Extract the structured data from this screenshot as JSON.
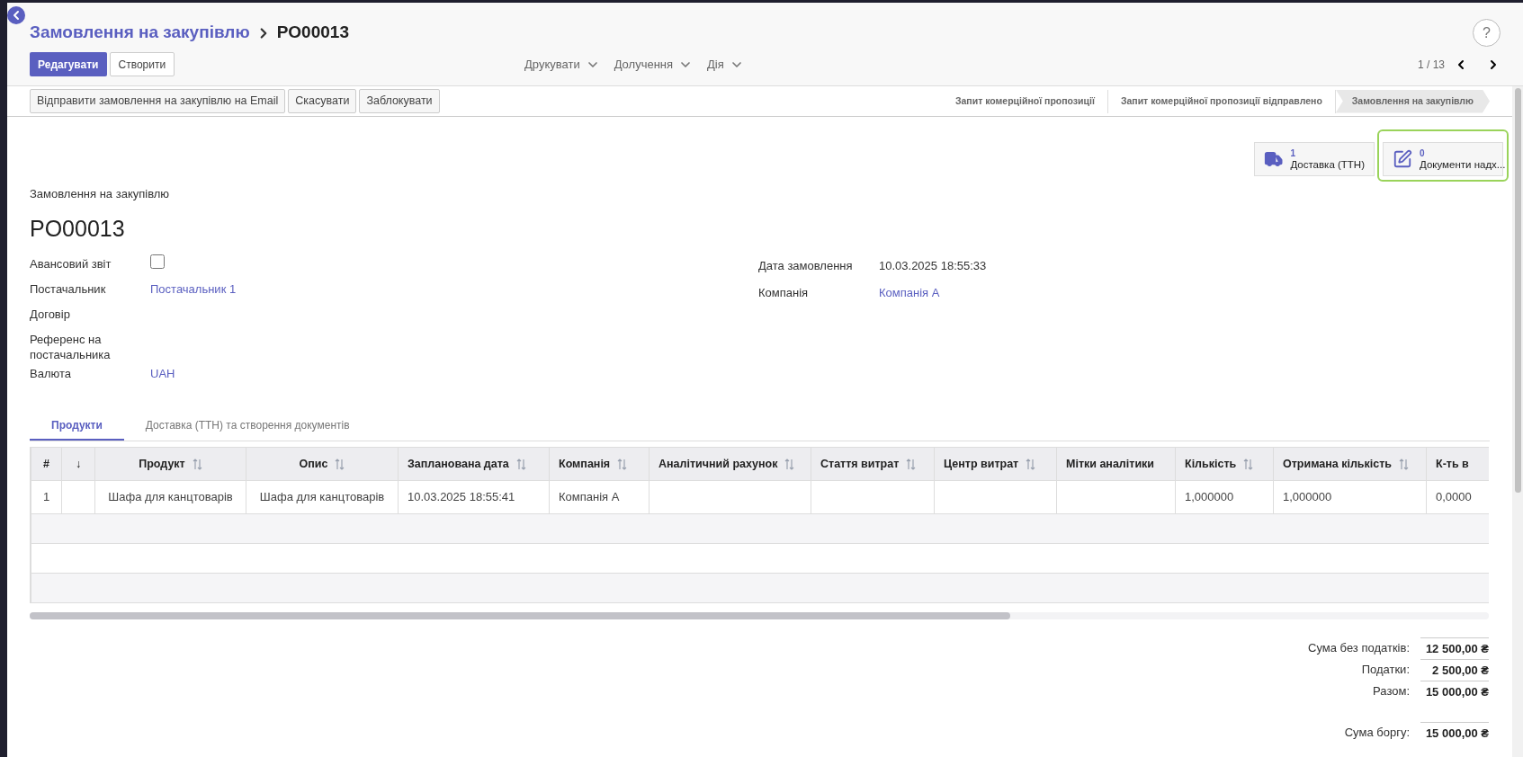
{
  "breadcrumb": {
    "parent": "Замовлення на закупівлю",
    "current": "PO00013"
  },
  "help": {
    "label": "?"
  },
  "main_buttons": [
    {
      "label": "Редагувати",
      "primary": true
    },
    {
      "label": "Створити",
      "primary": false
    }
  ],
  "dropdowns": [
    "Друкувати",
    "Долучення",
    "Дія"
  ],
  "pager": {
    "label": "1 / 13"
  },
  "action_buttons": [
    "Відправити замовлення на закупівлю на Email",
    "Скасувати",
    "Заблокувати"
  ],
  "status_stages": [
    {
      "label": "Запит комерційної пропозиції",
      "selected": false
    },
    {
      "label": "Запит комерційної пропозиції відправлено",
      "selected": false
    },
    {
      "label": "Замовлення на закупівлю",
      "selected": true
    }
  ],
  "smart_buttons": [
    {
      "kind": "truck",
      "count": "1",
      "label": "Доставка (ТТН)",
      "focused": false
    },
    {
      "kind": "edit",
      "count": "0",
      "label": "Документи надх...",
      "focused": true
    }
  ],
  "form": {
    "subtitle": "Замовлення на закупівлю",
    "name": "PO00013",
    "left_fields": [
      {
        "label": "Авансовий звіт",
        "kind": "checkbox",
        "checked": false
      },
      {
        "label": "Постачальник",
        "kind": "link",
        "value": "Постачальник 1"
      },
      {
        "label": "Договір",
        "kind": "text"
      },
      {
        "label": "Референс на постачальника",
        "kind": "text"
      },
      {
        "label": "Валюта",
        "kind": "link",
        "value": "UAH"
      }
    ],
    "right_fields": [
      {
        "label": "Дата замовлення",
        "kind": "text",
        "value": "10.03.2025 18:55:33"
      },
      {
        "label": "Компанія",
        "kind": "link",
        "value": "Компанія A"
      }
    ]
  },
  "tabs": [
    {
      "label": "Продукти",
      "selected": true
    },
    {
      "label": "Доставка (ТТН) та створення документів",
      "selected": false
    }
  ],
  "table": {
    "columns": [
      {
        "label": "#",
        "sortable": false
      },
      {
        "label": "↓",
        "sortable": false
      },
      {
        "label": "Продукт",
        "sortable": true
      },
      {
        "label": "Опис",
        "sortable": true
      },
      {
        "label": "Запланована дата",
        "sortable": true
      },
      {
        "label": "Компанія",
        "sortable": true
      },
      {
        "label": "Аналітичний рахунок",
        "sortable": true
      },
      {
        "label": "Стаття витрат",
        "sortable": true
      },
      {
        "label": "Центр витрат",
        "sortable": true
      },
      {
        "label": "Мітки аналітики",
        "sortable": false
      },
      {
        "label": "Кількість",
        "sortable": true
      },
      {
        "label": "Отримана кількість",
        "sortable": true
      },
      {
        "label": "К-ть в",
        "sortable": false
      }
    ],
    "rows": [
      [
        "1",
        "",
        "Шафа для канцтоварів",
        "Шафа для канцтоварів",
        "10.03.2025 18:55:41",
        "Компанія A",
        "",
        "",
        "",
        "",
        "1,000000",
        "1,000000",
        "0,0000"
      ]
    ]
  },
  "totals": [
    {
      "label": "Сума без податків:",
      "value": "12 500,00 ₴"
    },
    {
      "label": "Податки:",
      "value": "2 500,00 ₴"
    },
    {
      "label": "Разом:",
      "value": "15 000,00 ₴"
    },
    {
      "label": "Сума боргу:",
      "value": "15 000,00 ₴"
    }
  ]
}
